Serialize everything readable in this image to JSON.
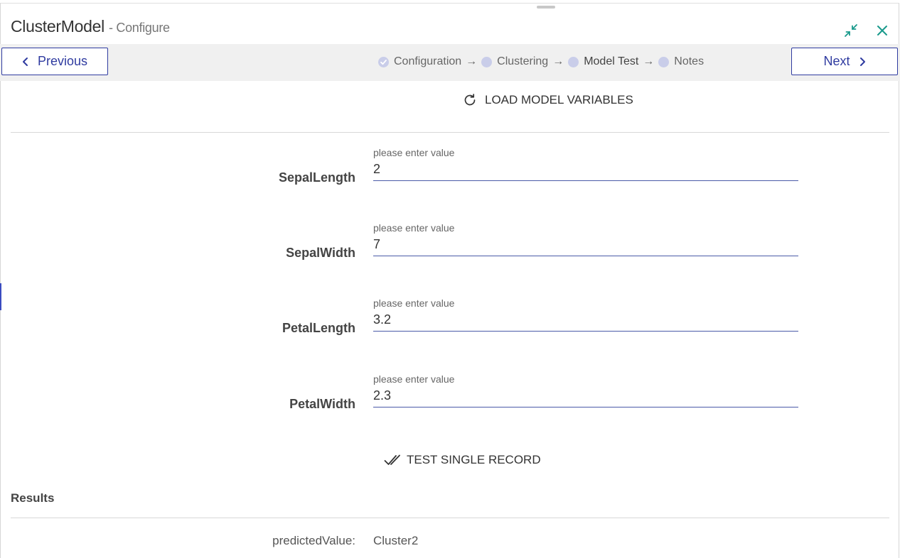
{
  "window": {
    "title": "ClusterModel",
    "subtitle": "- Configure"
  },
  "nav": {
    "previous_label": "Previous",
    "next_label": "Next"
  },
  "steps": [
    {
      "label": "Configuration",
      "state": "completed"
    },
    {
      "label": "Clustering",
      "state": "pending"
    },
    {
      "label": "Model Test",
      "state": "active"
    },
    {
      "label": "Notes",
      "state": "pending"
    }
  ],
  "step_separator": "→",
  "load_button_label": "LOAD MODEL VARIABLES",
  "fields": [
    {
      "label": "SepalLength",
      "hint": "please enter value",
      "value": "2"
    },
    {
      "label": "SepalWidth",
      "hint": "please enter value",
      "value": "7"
    },
    {
      "label": "PetalLength",
      "hint": "please enter value",
      "value": "3.2"
    },
    {
      "label": "PetalWidth",
      "hint": "please enter value",
      "value": "2.3"
    }
  ],
  "test_button_label": "TEST SINGLE RECORD",
  "results": {
    "heading": "Results",
    "label": "predictedValue:",
    "value": "Cluster2"
  },
  "colors": {
    "accent": "#2f3ba0",
    "teal": "#1a9a8c",
    "step_dot": "#c9cde9",
    "step_bar_bg": "#f0f0f0"
  },
  "icons": {
    "minimize": "compress-arrows-icon",
    "close": "close-icon",
    "reload": "refresh-icon",
    "test": "double-check-icon"
  }
}
